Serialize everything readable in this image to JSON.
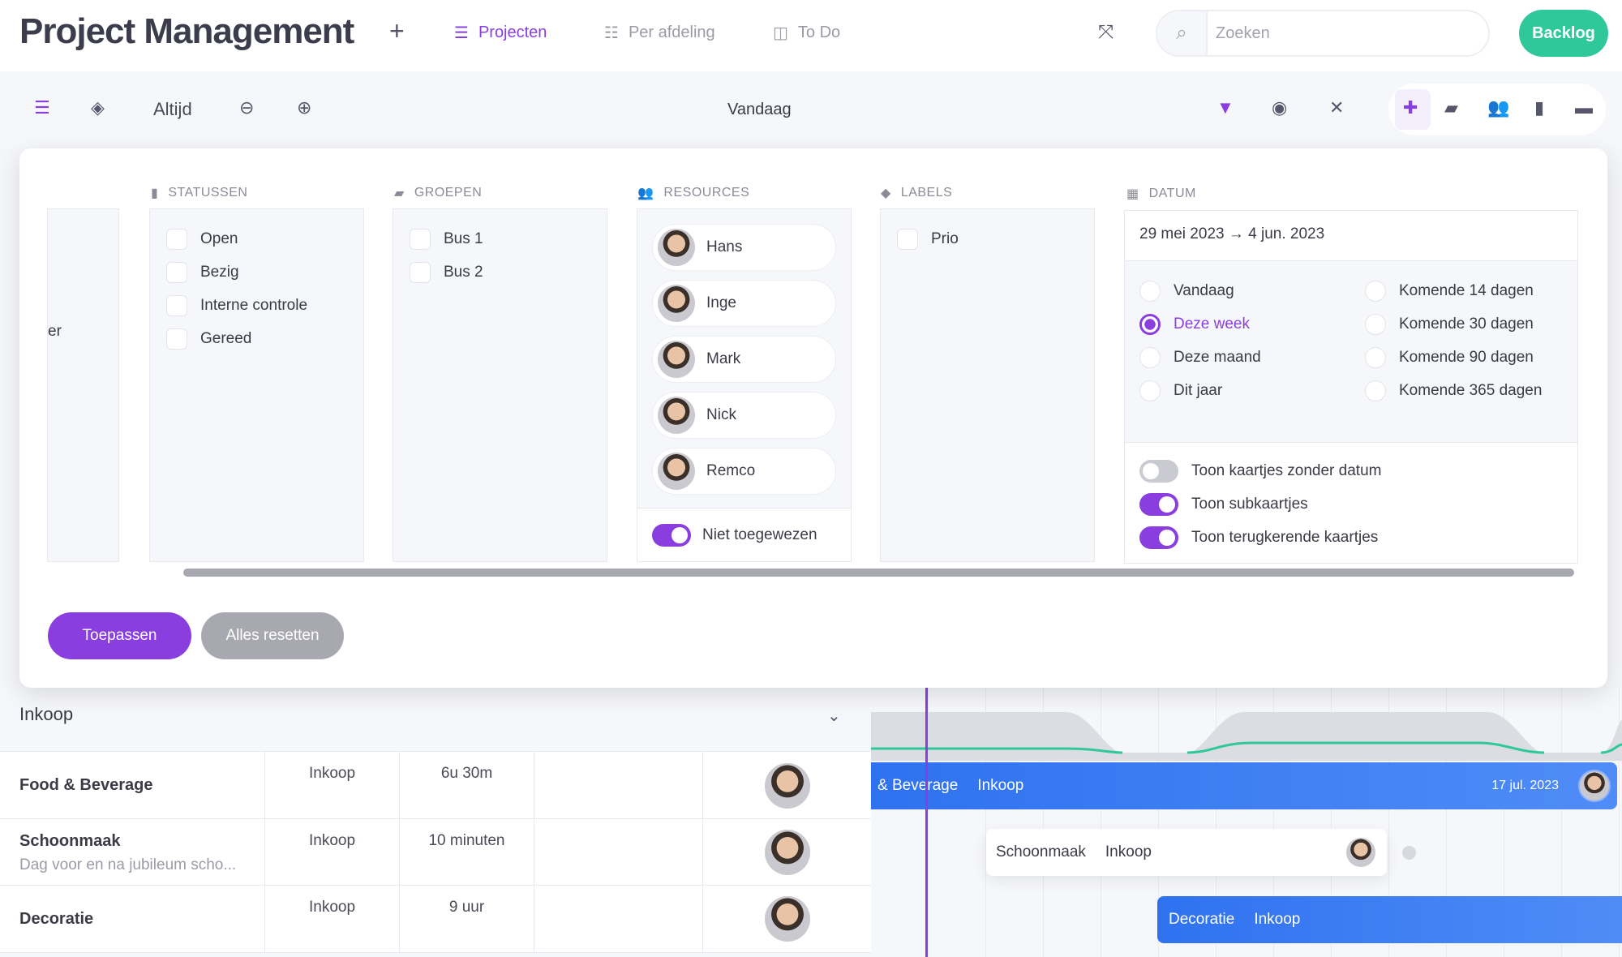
{
  "header": {
    "title": "Project Management",
    "add": "+",
    "nav": [
      {
        "label": "Projecten",
        "icon": "list-icon",
        "active": true
      },
      {
        "label": "Per afdeling",
        "icon": "list-icon"
      },
      {
        "label": "To Do",
        "icon": "columns-icon"
      }
    ],
    "search_placeholder": "Zoeken",
    "backlog": "Backlog"
  },
  "toolbar": {
    "range": "Altijd",
    "today": "Vandaag",
    "accent": "#8a3ee0"
  },
  "filter": {
    "partial_item": "er",
    "statussen": {
      "title": "STATUSSEN",
      "items": [
        "Open",
        "Bezig",
        "Interne controle",
        "Gereed"
      ]
    },
    "groepen": {
      "title": "GROEPEN",
      "items": [
        "Bus 1",
        "Bus 2"
      ]
    },
    "resources": {
      "title": "RESOURCES",
      "items": [
        "Hans",
        "Inge",
        "Mark",
        "Nick",
        "Remco"
      ],
      "unassigned": "Niet toegewezen",
      "unassigned_on": true
    },
    "labels": {
      "title": "LABELS",
      "items": [
        "Prio"
      ]
    },
    "datum": {
      "title": "DATUM",
      "range": "29 mei 2023 → 4 jun. 2023",
      "options_left": [
        "Vandaag",
        "Deze week",
        "Deze maand",
        "Dit jaar"
      ],
      "options_right": [
        "Komende 14 dagen",
        "Komende 30 dagen",
        "Komende 90 dagen",
        "Komende 365 dagen"
      ],
      "selected": "Deze week",
      "toggles": [
        {
          "label": "Toon kaartjes zonder datum",
          "on": false
        },
        {
          "label": "Toon subkaartjes",
          "on": true
        },
        {
          "label": "Toon terugkerende kaartjes",
          "on": true
        }
      ]
    },
    "apply": "Toepassen",
    "reset": "Alles resetten"
  },
  "group": {
    "name": "Inkoop"
  },
  "rows": [
    {
      "name": "Food & Beverage",
      "sub": "",
      "dept": "Inkoop",
      "duration": "6u 30m"
    },
    {
      "name": "Schoonmaak",
      "sub": "Dag voor en na jubileum scho...",
      "dept": "Inkoop",
      "duration": "10 minuten"
    },
    {
      "name": "Decoratie",
      "sub": "",
      "dept": "Inkoop",
      "duration": "9 uur"
    }
  ],
  "gantt": {
    "food": {
      "name": "& Beverage",
      "dept": "Inkoop",
      "date": "17 jul. 2023"
    },
    "schoon": {
      "name": "Schoonmaak",
      "dept": "Inkoop"
    },
    "deco": {
      "name": "Decoratie",
      "dept": "Inkoop"
    }
  }
}
